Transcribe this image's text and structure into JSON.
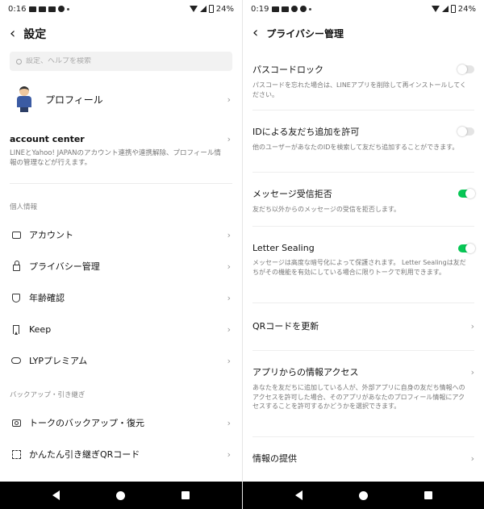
{
  "left": {
    "status": {
      "time": "0:16",
      "battery": "24%"
    },
    "header": {
      "title": "設定"
    },
    "search": {
      "placeholder": "設定、ヘルプを検索"
    },
    "profile": {
      "label": "プロフィール"
    },
    "account_center": {
      "title": "account center",
      "desc": "LINEとYahoo! JAPANのアカウント連携や連携解除、プロフィール情報の管理などが行えます。"
    },
    "sections": [
      {
        "label": "個人情報",
        "items": [
          {
            "label": "アカウント",
            "icon": "id-card-icon"
          },
          {
            "label": "プライバシー管理",
            "icon": "lock-icon"
          },
          {
            "label": "年齢確認",
            "icon": "shield-icon"
          },
          {
            "label": "Keep",
            "icon": "bookmark-icon"
          },
          {
            "label": "LYPプレミアム",
            "icon": "lyp-icon"
          }
        ]
      },
      {
        "label": "バックアップ・引き継ぎ",
        "items": [
          {
            "label": "トークのバックアップ・復元",
            "icon": "backup-icon"
          },
          {
            "label": "かんたん引き継ぎQRコード",
            "icon": "qr-code-icon"
          }
        ]
      }
    ]
  },
  "right": {
    "status": {
      "time": "0:19",
      "battery": "24%"
    },
    "header": {
      "title": "プライバシー管理"
    },
    "items": [
      {
        "title": "パスコードロック",
        "desc": "パスコードを忘れた場合は、LINEアプリを削除して再インストールしてください。",
        "toggle": "off"
      },
      {
        "title": "IDによる友だち追加を許可",
        "desc": "他のユーザーがあなたのIDを検索して友だち追加することができます。",
        "toggle": "off"
      },
      {
        "title": "メッセージ受信拒否",
        "desc": "友だち以外からのメッセージの受信を拒否します。",
        "toggle": "on"
      },
      {
        "title": "Letter Sealing",
        "desc": "メッセージは高度な暗号化によって保護されます。 Letter Sealingは友だちがその機能を有効にしている場合に限りトークで利用できます。",
        "toggle": "on"
      },
      {
        "title": "QRコードを更新",
        "desc": "",
        "toggle": "chevron"
      },
      {
        "title": "アプリからの情報アクセス",
        "desc": "あなたを友だちに追加している人が、外部アプリに自身の友だち情報へのアクセスを許可した場合、そのアプリがあなたのプロフィール情報にアクセスすることを許可するかどうかを選択できます。",
        "toggle": "chevron"
      },
      {
        "title": "情報の提供",
        "desc": "",
        "toggle": "chevron"
      }
    ]
  },
  "colors": {
    "toggle_on": "#06c755",
    "toggle_off": "#e4e4e4"
  }
}
